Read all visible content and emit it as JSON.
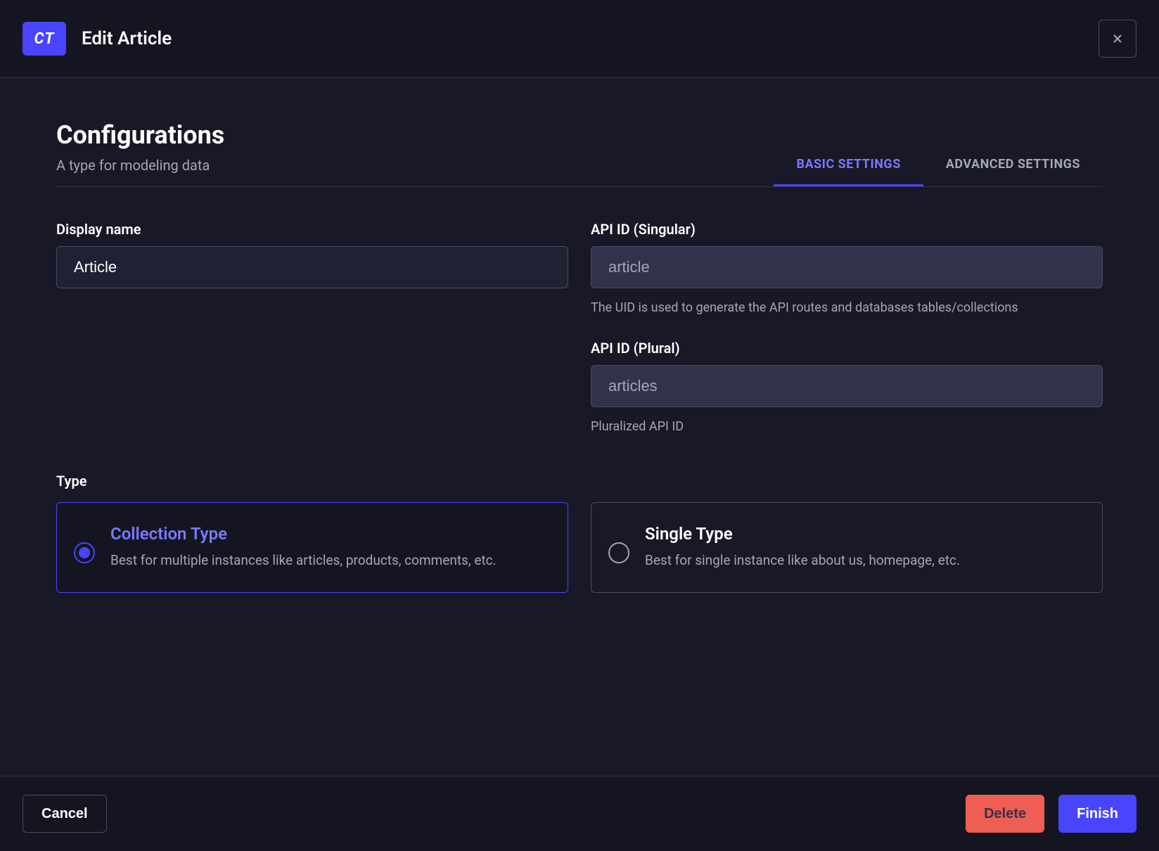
{
  "header": {
    "badge": "CT",
    "title": "Edit Article"
  },
  "section": {
    "title": "Configurations",
    "subtitle": "A type for modeling data"
  },
  "tabs": {
    "basic": "BASIC SETTINGS",
    "advanced": "ADVANCED SETTINGS"
  },
  "fields": {
    "displayName": {
      "label": "Display name",
      "value": "Article"
    },
    "apiIdSingular": {
      "label": "API ID (Singular)",
      "value": "article",
      "hint": "The UID is used to generate the API routes and databases tables/collections"
    },
    "apiIdPlural": {
      "label": "API ID (Plural)",
      "value": "articles",
      "hint": "Pluralized API ID"
    }
  },
  "type": {
    "label": "Type",
    "options": {
      "collection": {
        "title": "Collection Type",
        "desc": "Best for multiple instances like articles, products, comments, etc."
      },
      "single": {
        "title": "Single Type",
        "desc": "Best for single instance like about us, homepage, etc."
      }
    }
  },
  "footer": {
    "cancel": "Cancel",
    "delete": "Delete",
    "finish": "Finish"
  }
}
